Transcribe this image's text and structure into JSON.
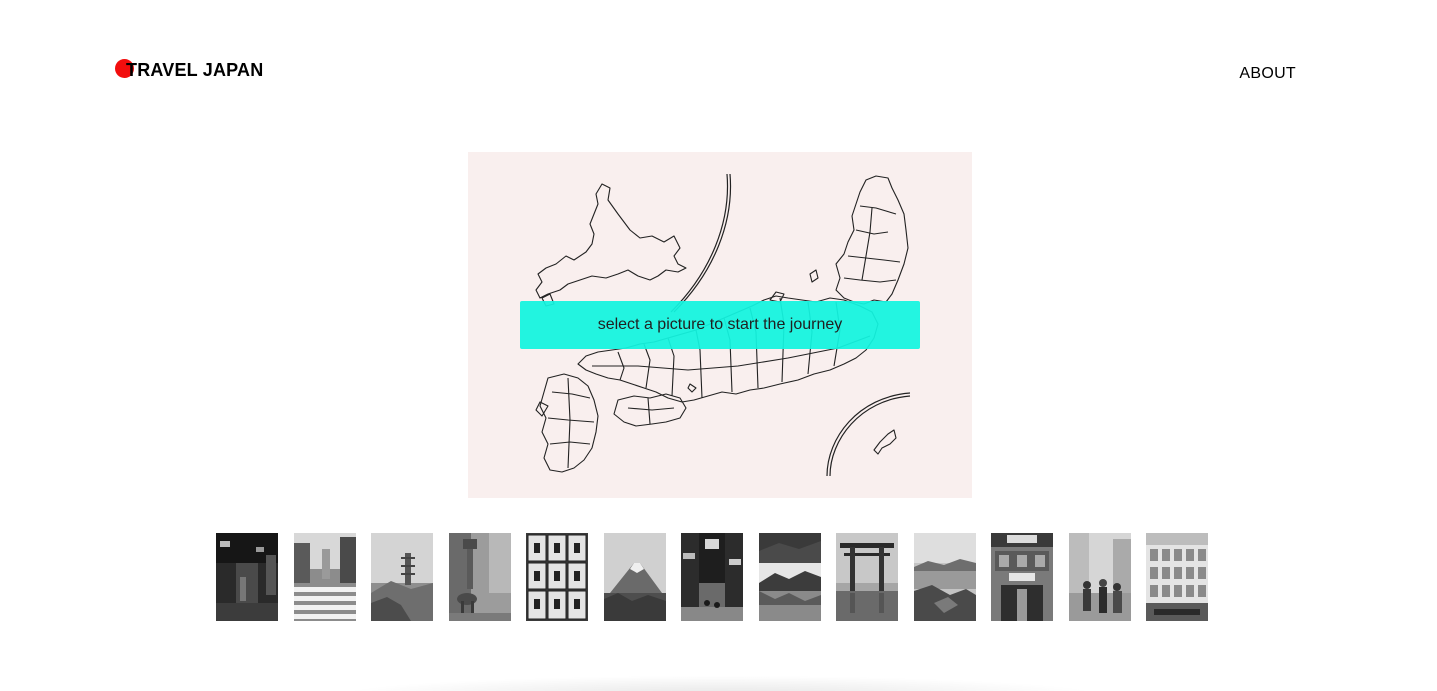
{
  "header": {
    "logo_text": "TRAVEL JAPAN",
    "about_label": "ABOUT"
  },
  "colors": {
    "logo_dot": "#f20d0d",
    "map_background": "#f9efee",
    "button_background": "#12f5e0",
    "map_outline": "#222222"
  },
  "map": {
    "button_label": "select a picture to start the journey"
  },
  "thumbnails": [
    {
      "name": "alley-night"
    },
    {
      "name": "crosswalk"
    },
    {
      "name": "pagoda-landscape"
    },
    {
      "name": "deer-lantern"
    },
    {
      "name": "sake-barrels"
    },
    {
      "name": "mount-fuji"
    },
    {
      "name": "shopping-street"
    },
    {
      "name": "lake-forest"
    },
    {
      "name": "torii-gate"
    },
    {
      "name": "coastline"
    },
    {
      "name": "shop-front"
    },
    {
      "name": "street-crowd"
    },
    {
      "name": "vending-machine"
    }
  ]
}
